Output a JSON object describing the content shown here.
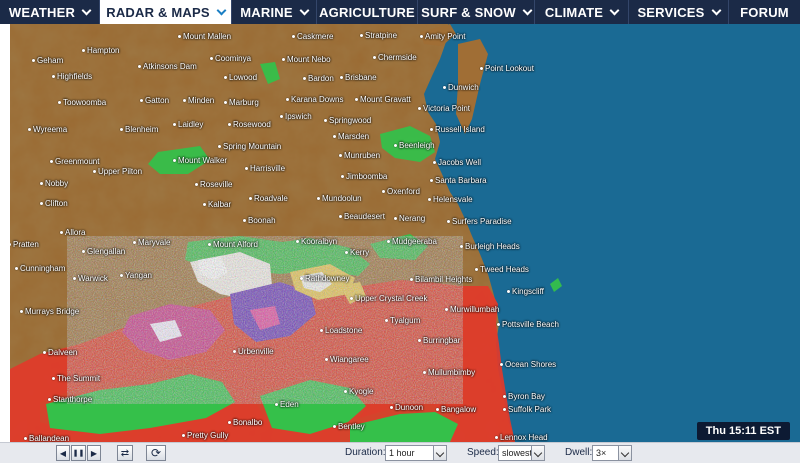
{
  "nav": {
    "items": [
      {
        "label": "WEATHER",
        "active": false,
        "dropdown": true
      },
      {
        "label": "RADAR & MAPS",
        "active": true,
        "dropdown": true
      },
      {
        "label": "MARINE",
        "active": false,
        "dropdown": true
      },
      {
        "label": "AGRICULTURE",
        "active": false,
        "dropdown": false
      },
      {
        "label": "SURF & SNOW",
        "active": false,
        "dropdown": true
      },
      {
        "label": "CLIMATE",
        "active": false,
        "dropdown": true
      },
      {
        "label": "SERVICES",
        "active": false,
        "dropdown": true
      },
      {
        "label": "FORUM",
        "active": false,
        "dropdown": false
      }
    ]
  },
  "map": {
    "timestamp": "Thu 15:11 EST",
    "places": [
      "Mount Mallen",
      "Caskmere",
      "Stratpine",
      "Hampton",
      "Amity Point",
      "Chermside",
      "Dunwich",
      "Point Lookout",
      "Geham",
      "Highfields",
      "Atkinsons Dam",
      "Coominya",
      "Mount Nebo",
      "Lowood",
      "Bardon",
      "Brisbane",
      "Gatton",
      "Minden",
      "Marburg",
      "Karana Downs",
      "Mount Gravatt",
      "Victoria Point",
      "Toowoomba",
      "Russell Island",
      "Laidley",
      "Rosewood",
      "Ipswich",
      "Springwood",
      "Wyreema",
      "Blenheim",
      "Marsden",
      "Spring Mountain",
      "Harrisville",
      "Beenleigh",
      "Greenmount",
      "Munruben",
      "Jacobs Well",
      "Mount Walker",
      "Santa Barbara",
      "Nobby",
      "Upper Pilton",
      "Roseville",
      "Jimboomba",
      "Oxenford",
      "Helensvale",
      "Clifton",
      "Kalbar",
      "Roadvale",
      "Mundoolun",
      "Surfers Paradise",
      "Boonah",
      "Beaudesert",
      "Nerang",
      "Allora",
      "Kooralbyn",
      "Mudgeeraba",
      "Burleigh Heads",
      "Mount Alford",
      "Kerry",
      "Pratten",
      "Glengallan",
      "Maryvale",
      "Tweed Heads",
      "Cunningham",
      "Warwick",
      "Yangan",
      "Rathdowney",
      "Bilambil Heights",
      "Kingscliff",
      "Upper Crystal Creek",
      "Murrays Bridge",
      "Murwillumbah",
      "Loadstone",
      "Tyalgum",
      "Pottsville Beach",
      "Burringbar",
      "Dalveen",
      "Urbenville",
      "Wiangaree",
      "Ocean Shores",
      "Mullumbimby",
      "The Summit",
      "Stanthorpe",
      "Kyogle",
      "Byron Bay",
      "Suffolk Park",
      "Eden",
      "Bonalbo",
      "Dunoon",
      "Bangalow",
      "Pretty Gully",
      "Lennox Head",
      "Ballandean",
      "Bentley"
    ]
  },
  "controls": {
    "prev_label": "◀",
    "pause_label": "❚❚",
    "next_label": "▶",
    "swap_label": "⇄",
    "refresh_label": "⟳",
    "duration_label": "Duration:",
    "duration_value": "1 hour",
    "speed_label": "Speed:",
    "speed_value": "slowest",
    "dwell_label": "Dwell:",
    "dwell_value": "3×"
  },
  "colors": {
    "nav_bg": "#1b2a47",
    "land": "#9a6a32",
    "ocean": "#1a6a94",
    "radar_light": "#35c04a",
    "radar_heavy": "#e23a2a"
  }
}
